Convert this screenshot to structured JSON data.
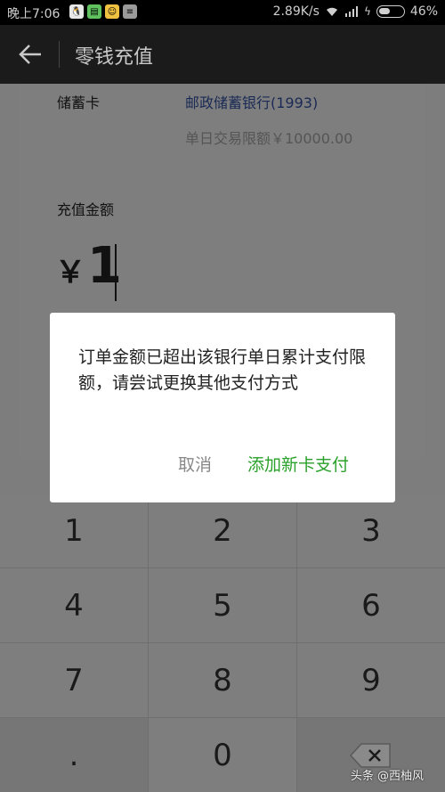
{
  "status_bar": {
    "time": "晚上7:06",
    "network_speed": "2.89K/s",
    "battery_percent": "46%",
    "battery_level": 0.46,
    "app_icons": [
      "qq-icon",
      "message-icon",
      "emoji-app-icon",
      "notes-icon"
    ]
  },
  "app_bar": {
    "title": "零钱充值"
  },
  "card": {
    "label": "储蓄卡",
    "bank_name": "邮政储蓄银行(1993)",
    "daily_limit": "单日交易限额￥10000.00"
  },
  "amount": {
    "label": "充值金额",
    "currency": "￥",
    "value": "1"
  },
  "dialog": {
    "message": "订单金额已超出该银行单日累计支付限额，请尝试更换其他支付方式",
    "cancel_label": "取消",
    "add_card_label": "添加新卡支付"
  },
  "keypad": {
    "keys": [
      "1",
      "2",
      "3",
      "4",
      "5",
      "6",
      "7",
      "8",
      "9",
      ".",
      "0"
    ]
  },
  "watermark": "头条 @西柚风",
  "colors": {
    "accent_green": "#2aa12a",
    "bank_name_blue": "#1a2a55"
  }
}
